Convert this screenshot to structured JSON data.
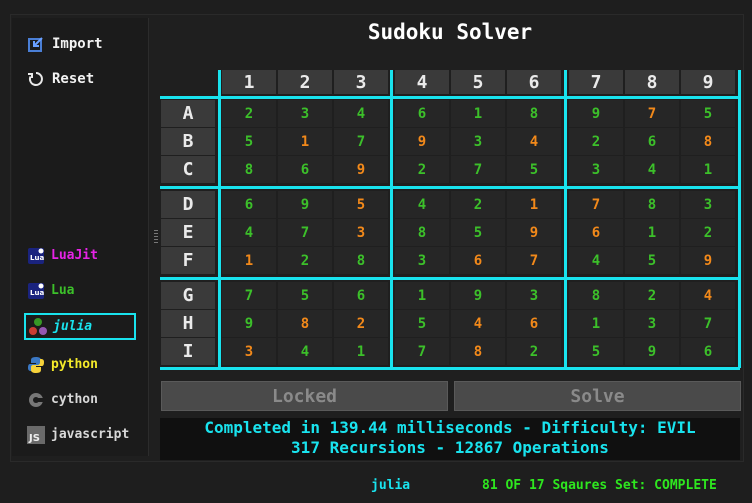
{
  "title": "Sudoku Solver",
  "sidebar": {
    "import_label": "Import",
    "reset_label": "Reset",
    "languages": [
      {
        "label": "LuaJit",
        "color": "#e623e6",
        "icon": "luajit-icon"
      },
      {
        "label": "Lua",
        "color": "#3cc02a",
        "icon": "lua-icon"
      },
      {
        "label": "julia",
        "color": "#19e3ee",
        "icon": "julia-icon",
        "active": true
      },
      {
        "label": "python",
        "color": "#f4ea2a",
        "icon": "python-icon"
      },
      {
        "label": "cython",
        "color": "#d8d8d8",
        "icon": "cython-icon"
      },
      {
        "label": "javascript",
        "color": "#d8d8d8",
        "icon": "javascript-icon"
      }
    ]
  },
  "grid": {
    "col_headers": [
      "1",
      "2",
      "3",
      "4",
      "5",
      "6",
      "7",
      "8",
      "9"
    ],
    "row_headers": [
      "A",
      "B",
      "C",
      "D",
      "E",
      "F",
      "G",
      "H",
      "I"
    ],
    "values": [
      [
        "2",
        "3",
        "4",
        "6",
        "1",
        "8",
        "9",
        "7",
        "5"
      ],
      [
        "5",
        "1",
        "7",
        "9",
        "3",
        "4",
        "2",
        "6",
        "8"
      ],
      [
        "8",
        "6",
        "9",
        "2",
        "7",
        "5",
        "3",
        "4",
        "1"
      ],
      [
        "6",
        "9",
        "5",
        "4",
        "2",
        "1",
        "7",
        "8",
        "3"
      ],
      [
        "4",
        "7",
        "3",
        "8",
        "5",
        "9",
        "6",
        "1",
        "2"
      ],
      [
        "1",
        "2",
        "8",
        "3",
        "6",
        "7",
        "4",
        "5",
        "9"
      ],
      [
        "7",
        "5",
        "6",
        "1",
        "9",
        "3",
        "8",
        "2",
        "4"
      ],
      [
        "9",
        "8",
        "2",
        "5",
        "4",
        "6",
        "1",
        "3",
        "7"
      ],
      [
        "3",
        "4",
        "1",
        "7",
        "8",
        "2",
        "5",
        "9",
        "6"
      ]
    ],
    "colors": [
      [
        "g",
        "g",
        "g",
        "g",
        "g",
        "g",
        "g",
        "o",
        "g"
      ],
      [
        "g",
        "o",
        "g",
        "o",
        "g",
        "o",
        "g",
        "g",
        "o"
      ],
      [
        "g",
        "g",
        "o",
        "g",
        "g",
        "g",
        "g",
        "g",
        "g"
      ],
      [
        "g",
        "g",
        "o",
        "g",
        "g",
        "o",
        "o",
        "g",
        "g"
      ],
      [
        "g",
        "g",
        "o",
        "g",
        "g",
        "o",
        "o",
        "g",
        "g"
      ],
      [
        "o",
        "g",
        "g",
        "g",
        "o",
        "o",
        "g",
        "g",
        "o"
      ],
      [
        "g",
        "g",
        "g",
        "g",
        "g",
        "g",
        "g",
        "g",
        "o"
      ],
      [
        "g",
        "o",
        "o",
        "g",
        "o",
        "o",
        "g",
        "g",
        "g"
      ],
      [
        "o",
        "g",
        "g",
        "g",
        "o",
        "g",
        "g",
        "g",
        "g"
      ]
    ]
  },
  "actions": {
    "locked_label": "Locked",
    "solve_label": "Solve"
  },
  "status": {
    "line1": "Completed in 139.44 milliseconds - Difficulty: EVIL",
    "line2": "317 Recursions - 12867 Operations"
  },
  "footer": {
    "language": "julia",
    "status": "81 OF 17 Sqaures Set: COMPLETE"
  },
  "colors": {
    "accent": "#19e3ee",
    "given": "#3cc02a",
    "solved": "#f2891a"
  }
}
